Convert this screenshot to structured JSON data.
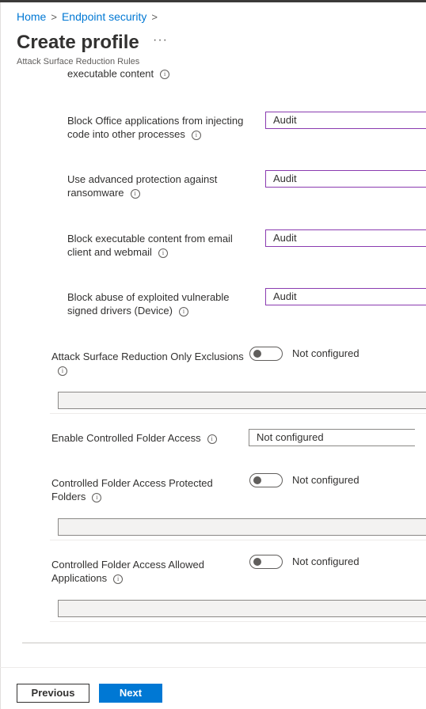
{
  "breadcrumb": {
    "items": [
      "Home",
      "Endpoint security"
    ],
    "separator": ">"
  },
  "page": {
    "title": "Create profile",
    "more": "···",
    "subtitle": "Attack Surface Reduction Rules"
  },
  "clipped_label": "executable content",
  "info_glyph": "i",
  "asr_rules": [
    {
      "label_line1": "Block Office applications from injecting",
      "label_line2": "code into other processes",
      "value": "Audit"
    },
    {
      "label_line1": "Use advanced protection against",
      "label_line2": "ransomware",
      "value": "Audit"
    },
    {
      "label_line1": "Block executable content from email",
      "label_line2": "client and webmail",
      "value": "Audit"
    },
    {
      "label_line1": "Block abuse of exploited vulnerable",
      "label_line2": "signed drivers (Device)",
      "value": "Audit"
    }
  ],
  "asr_only_exclusions": {
    "label": "Attack Surface Reduction Only Exclusions",
    "toggle_state": "Not configured",
    "input_value": ""
  },
  "controlled_folder_access": {
    "label": "Enable Controlled Folder Access",
    "value": "Not configured"
  },
  "cfa_protected_folders": {
    "label_line1": "Controlled Folder Access Protected",
    "label_line2": "Folders",
    "toggle_state": "Not configured",
    "input_value": ""
  },
  "cfa_allowed_apps": {
    "label_line1": "Controlled Folder Access Allowed",
    "label_line2": "Applications",
    "toggle_state": "Not configured",
    "input_value": ""
  },
  "footer": {
    "previous_label": "Previous",
    "next_label": "Next"
  },
  "colors": {
    "accent": "#0078d4",
    "dropdown_focus_border": "#8a3bb0",
    "text": "#323130"
  }
}
